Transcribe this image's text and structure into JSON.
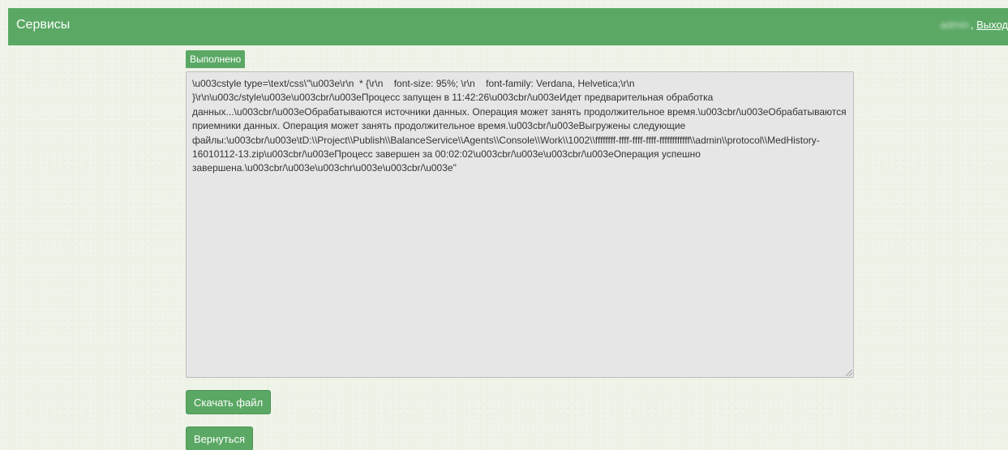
{
  "header": {
    "title": "Сервисы",
    "user_name": "admin",
    "separator": ",",
    "logout_label": "Выход"
  },
  "status": {
    "label": "Выполнено"
  },
  "output": {
    "text": "\\u003cstyle type=\\text/css\\\"\\u003e\\r\\n  * {\\r\\n    font-size: 95%; \\r\\n    font-family: Verdana, Helvetica;\\r\\n  }\\r\\n\\u003c/style\\u003e\\u003cbr/\\u003eПроцесс запущен в 11:42:26\\u003cbr/\\u003eИдет предварительная обработка данных...\\u003cbr/\\u003eОбрабатываются источники данных. Операция может занять продолжительное время.\\u003cbr/\\u003eОбрабатываются приемники данных. Операция может занять продолжительное время.\\u003cbr/\\u003eВыгружены следующие файлы:\\u003cbr/\\u003e\\tD:\\\\Project\\\\Publish\\\\BalanceService\\\\Agents\\\\Console\\\\Work\\\\1002\\\\ffffffff-ffff-ffff-ffff-ffffffffffff\\\\admin\\\\protocol\\\\MedHistory-16010112-13.zip\\u003cbr/\\u003eПроцесс завершен за 00:02:02\\u003cbr/\\u003e\\u003cbr/\\u003eОперация успешно завершена.\\u003cbr/\\u003e\\u003chr\\u003e\\u003cbr/\\u003e\""
  },
  "actions": {
    "download_label": "Скачать файл",
    "back_label": "Вернуться"
  },
  "colors": {
    "accent": "#5aa864",
    "background": "#eef3e8",
    "output_bg": "#e6e6e6"
  }
}
